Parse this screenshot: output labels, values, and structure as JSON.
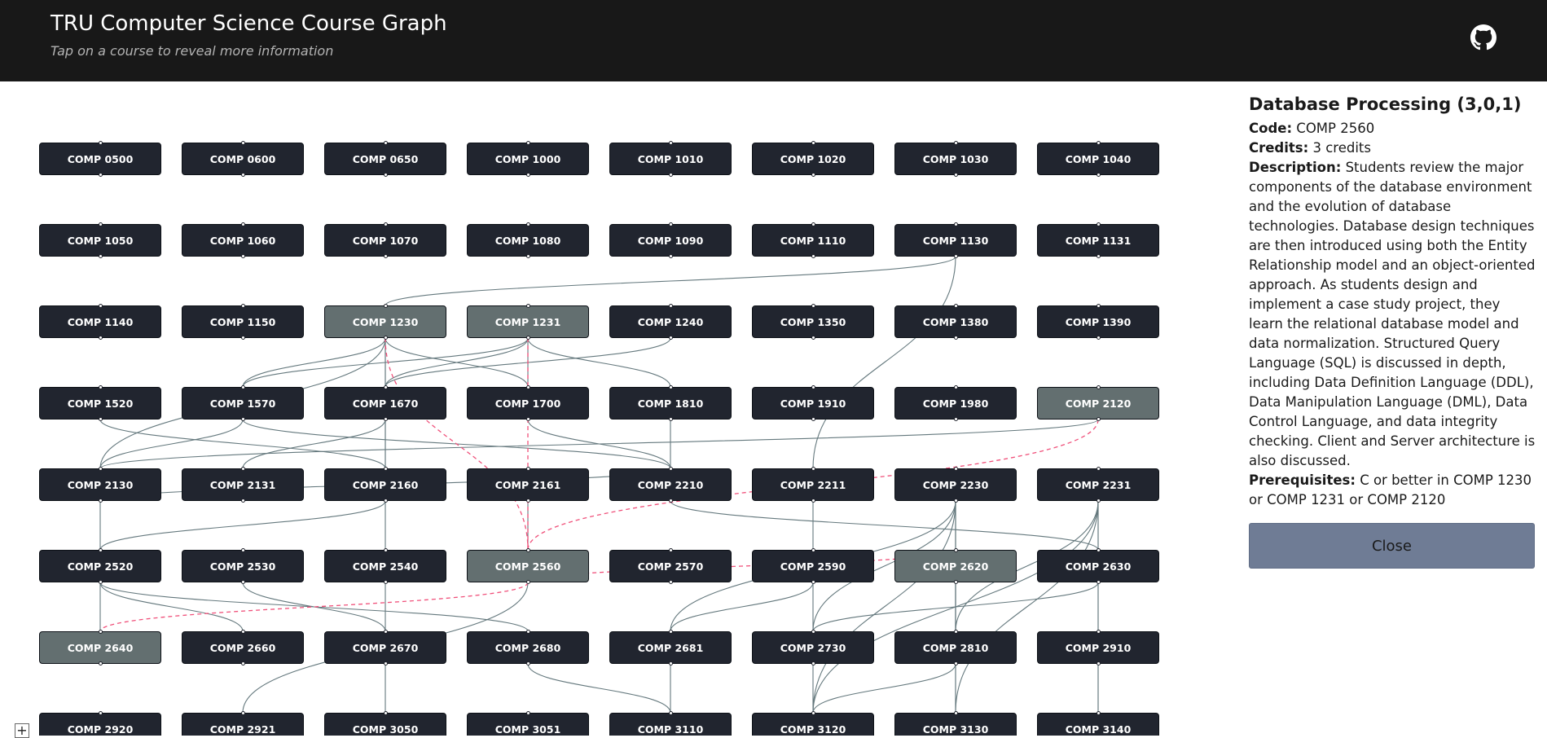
{
  "header": {
    "title": "TRU Computer Science Course Graph",
    "subtitle": "Tap on a course to reveal more information",
    "github_icon": "github-icon"
  },
  "colors": {
    "node": "#21252f",
    "node_selected": "#636f70",
    "edge": "#64787d",
    "edge_prereq": "#f0507a"
  },
  "graph": {
    "rows": [
      [
        "COMP 0500",
        "COMP 0600",
        "COMP 0650",
        "COMP 1000",
        "COMP 1010",
        "COMP 1020",
        "COMP 1030",
        "COMP 1040"
      ],
      [
        "COMP 1050",
        "COMP 1060",
        "COMP 1070",
        "COMP 1080",
        "COMP 1090",
        "COMP 1110",
        "COMP 1130",
        "COMP 1131"
      ],
      [
        "COMP 1140",
        "COMP 1150",
        "COMP 1230",
        "COMP 1231",
        "COMP 1240",
        "COMP 1350",
        "COMP 1380",
        "COMP 1390"
      ],
      [
        "COMP 1520",
        "COMP 1570",
        "COMP 1670",
        "COMP 1700",
        "COMP 1810",
        "COMP 1910",
        "COMP 1980",
        "COMP 2120"
      ],
      [
        "COMP 2130",
        "COMP 2131",
        "COMP 2160",
        "COMP 2161",
        "COMP 2210",
        "COMP 2211",
        "COMP 2230",
        "COMP 2231"
      ],
      [
        "COMP 2520",
        "COMP 2530",
        "COMP 2540",
        "COMP 2560",
        "COMP 2570",
        "COMP 2590",
        "COMP 2620",
        "COMP 2630"
      ],
      [
        "COMP 2640",
        "COMP 2660",
        "COMP 2670",
        "COMP 2680",
        "COMP 2681",
        "COMP 2730",
        "COMP 2810",
        "COMP 2910"
      ],
      [
        "COMP 2920",
        "COMP 2921",
        "COMP 3050",
        "COMP 3051",
        "COMP 3110",
        "COMP 3120",
        "COMP 3130",
        "COMP 3140"
      ]
    ],
    "highlighted": [
      "COMP 1230",
      "COMP 1231",
      "COMP 2120",
      "COMP 2560",
      "COMP 2620",
      "COMP 2640"
    ],
    "edges": [
      [
        "COMP 1130",
        "COMP 1230"
      ],
      [
        "COMP 1130",
        "COMP 2211"
      ],
      [
        "COMP 1230",
        "COMP 1570"
      ],
      [
        "COMP 1230",
        "COMP 1670"
      ],
      [
        "COMP 1230",
        "COMP 1700"
      ],
      [
        "COMP 1230",
        "COMP 2130"
      ],
      [
        "COMP 1230",
        "COMP 2160"
      ],
      [
        "COMP 1231",
        "COMP 1570"
      ],
      [
        "COMP 1231",
        "COMP 1670"
      ],
      [
        "COMP 1231",
        "COMP 1700"
      ],
      [
        "COMP 1231",
        "COMP 1810"
      ],
      [
        "COMP 1240",
        "COMP 1670"
      ],
      [
        "COMP 1520",
        "COMP 2160"
      ],
      [
        "COMP 1570",
        "COMP 2130"
      ],
      [
        "COMP 1570",
        "COMP 2210"
      ],
      [
        "COMP 1670",
        "COMP 2160"
      ],
      [
        "COMP 1670",
        "COMP 2131"
      ],
      [
        "COMP 1700",
        "COMP 2210"
      ],
      [
        "COMP 1810",
        "COMP 2210"
      ],
      [
        "COMP 2120",
        "COMP 2130"
      ],
      [
        "COMP 2130",
        "COMP 2520"
      ],
      [
        "COMP 2160",
        "COMP 2540"
      ],
      [
        "COMP 2160",
        "COMP 2520"
      ],
      [
        "COMP 2161",
        "COMP 2560"
      ],
      [
        "COMP 2210",
        "COMP 2630"
      ],
      [
        "COMP 2211",
        "COMP 2590"
      ],
      [
        "COMP 2230",
        "COMP 2620"
      ],
      [
        "COMP 2230",
        "COMP 2681"
      ],
      [
        "COMP 2230",
        "COMP 2730"
      ],
      [
        "COMP 2230",
        "COMP 2810"
      ],
      [
        "COMP 2230",
        "COMP 3120"
      ],
      [
        "COMP 2230",
        "COMP 3130"
      ],
      [
        "COMP 2231",
        "COMP 2630"
      ],
      [
        "COMP 2231",
        "COMP 2910"
      ],
      [
        "COMP 2231",
        "COMP 2810"
      ],
      [
        "COMP 2231",
        "COMP 3120"
      ],
      [
        "COMP 2231",
        "COMP 3130"
      ],
      [
        "COMP 2520",
        "COMP 2640"
      ],
      [
        "COMP 2520",
        "COMP 2660"
      ],
      [
        "COMP 2520",
        "COMP 2680"
      ],
      [
        "COMP 2530",
        "COMP 2670"
      ],
      [
        "COMP 2540",
        "COMP 2670"
      ],
      [
        "COMP 2560",
        "COMP 2921"
      ],
      [
        "COMP 2590",
        "COMP 2681"
      ],
      [
        "COMP 2590",
        "COMP 3120"
      ],
      [
        "COMP 2620",
        "COMP 2810"
      ],
      [
        "COMP 2620",
        "COMP 3130"
      ],
      [
        "COMP 2630",
        "COMP 2730"
      ],
      [
        "COMP 2630",
        "COMP 3140"
      ],
      [
        "COMP 2670",
        "COMP 3050"
      ],
      [
        "COMP 2680",
        "COMP 3110"
      ],
      [
        "COMP 2681",
        "COMP 3110"
      ],
      [
        "COMP 2810",
        "COMP 3120"
      ],
      [
        "COMP 2910",
        "COMP 3140"
      ],
      [
        "COMP 2130",
        "COMP 2210"
      ]
    ],
    "prereq_edges": [
      [
        "COMP 1230",
        "COMP 2560"
      ],
      [
        "COMP 1231",
        "COMP 2560"
      ],
      [
        "COMP 2120",
        "COMP 2560"
      ],
      [
        "COMP 2560",
        "COMP 2640"
      ],
      [
        "COMP 2560",
        "COMP 2620"
      ]
    ],
    "zoom_in_label": "+"
  },
  "details": {
    "title": "Database Processing (3,0,1)",
    "code_label": "Code:",
    "code": "COMP 2560",
    "credits_label": "Credits:",
    "credits": "3 credits",
    "description_label": "Description:",
    "description": "Students review the major components of the database environment and the evolution of database technologies. Database design techniques are then introduced using both the Entity Relationship model and an object-oriented approach. As students design and implement a case study project, they learn the relational database model and data normalization. Structured Query Language (SQL) is discussed in depth, including Data Definition Language (DDL), Data Manipulation Language (DML), Data Control Language, and data integrity checking. Client and Server architecture is also discussed.",
    "prerequisites_label": "Prerequisites:",
    "prerequisites": "C or better in COMP 1230 or COMP 1231 or COMP 2120",
    "close_label": "Close"
  }
}
